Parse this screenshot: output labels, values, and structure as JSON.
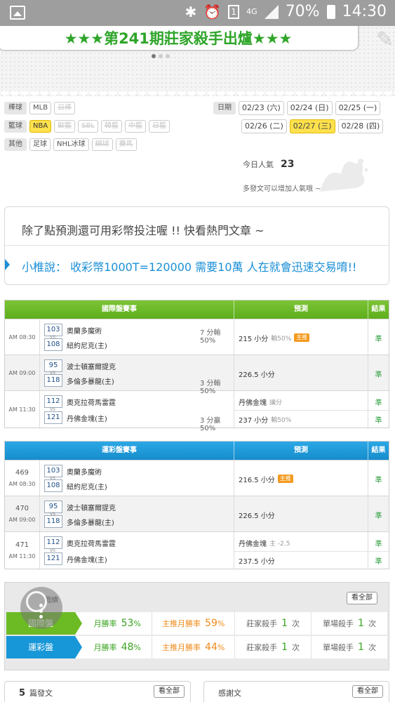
{
  "status_bar": {
    "battery": "70%",
    "time": "14:30",
    "network": "4G",
    "sim": "1"
  },
  "banner": {
    "text": "★★★第241期莊家殺手出爐★★★"
  },
  "filters": {
    "rows": [
      {
        "category": "棒球",
        "items": [
          {
            "label": "MLB",
            "state": "normal"
          },
          {
            "label": "日棒",
            "state": "off"
          }
        ]
      },
      {
        "category": "籃球",
        "items": [
          {
            "label": "NBA",
            "state": "on"
          },
          {
            "label": "歐籃",
            "state": "off"
          },
          {
            "label": "SBL",
            "state": "off"
          },
          {
            "label": "韓籃",
            "state": "off"
          },
          {
            "label": "中籃",
            "state": "off"
          },
          {
            "label": "日籃",
            "state": "off"
          }
        ]
      },
      {
        "category": "其他",
        "items": [
          {
            "label": "足球",
            "state": "normal"
          },
          {
            "label": "NHL冰球",
            "state": "normal"
          },
          {
            "label": "網球",
            "state": "off"
          },
          {
            "label": "賽馬",
            "state": "off"
          }
        ]
      }
    ]
  },
  "dates": {
    "label": "日期",
    "row1": [
      {
        "label": "02/23 (六)",
        "active": false
      },
      {
        "label": "02/24 (日)",
        "active": false
      },
      {
        "label": "02/25 (一)",
        "active": false
      }
    ],
    "row2": [
      {
        "label": "02/26 (二)",
        "active": false
      },
      {
        "label": "02/27 (三)",
        "active": true
      },
      {
        "label": "02/28 (四)",
        "active": false
      }
    ]
  },
  "popularity": {
    "label": "今日人氣",
    "value": "23",
    "hint": "多發文可以增加人氣哦 ~"
  },
  "notice": {
    "line1": "除了點預測還可用彩幣投注喔 !! 快看熱門文章 ~",
    "line2": "小椎說： 收彩幣1000T=120000 需要10萬 人在就會迅速交易唷!!"
  },
  "intl_table": {
    "header": {
      "match": "國際盤賽事",
      "prediction": "預測",
      "result": "結果"
    },
    "rows": [
      {
        "time": "AM 08:30",
        "away_no": "103",
        "away": "奧蘭多魔術",
        "home_no": "108",
        "home": "紐約尼克(主)",
        "line": "7 分輸50%",
        "line_on": "away",
        "preds": [
          {
            "text": "215 小分",
            "sub": "輸50%",
            "badge": "主推",
            "result": "準"
          }
        ]
      },
      {
        "time": "AM 09:00",
        "away_no": "95",
        "away": "波士頓塞爾提克",
        "home_no": "118",
        "home": "多倫多暴龍(主)",
        "line": "3 分輸50%",
        "line_on": "home",
        "preds": [
          {
            "text": "226.5 小分",
            "sub": "",
            "badge": "",
            "result": "準"
          }
        ]
      },
      {
        "time": "AM 11:30",
        "away_no": "112",
        "away": "奧克拉荷馬雷霆",
        "home_no": "121",
        "home": "丹佛金塊(主)",
        "line": "3 分贏50%",
        "line_on": "home",
        "preds": [
          {
            "text": "丹佛金塊",
            "sub": "讓分",
            "badge": "",
            "result": "準"
          },
          {
            "text": "237 小分",
            "sub": "輸50%",
            "badge": "",
            "result": "準"
          }
        ]
      }
    ]
  },
  "lottery_table": {
    "header": {
      "match": "運彩盤賽事",
      "prediction": "預測",
      "result": "結果"
    },
    "rows": [
      {
        "game_id": "469",
        "time": "AM 08:30",
        "away_no": "103",
        "away": "奧蘭多魔術",
        "home_no": "108",
        "home": "紐約尼克(主)",
        "preds": [
          {
            "text": "216.5 小分",
            "sub": "",
            "badge": "主推",
            "result": "準"
          }
        ]
      },
      {
        "game_id": "470",
        "time": "AM 09:00",
        "away_no": "95",
        "away": "波士頓塞爾提克",
        "home_no": "118",
        "home": "多倫多暴龍(主)",
        "preds": [
          {
            "text": "226.5 小分",
            "sub": "",
            "badge": "",
            "result": "準"
          }
        ]
      },
      {
        "game_id": "471",
        "time": "AM 11:30",
        "away_no": "112",
        "away": "奧克拉荷馬雷霆",
        "home_no": "121",
        "home": "丹佛金塊(主)",
        "preds": [
          {
            "text": "丹佛金塊",
            "sub": "主 -2.5",
            "badge": "",
            "result": "準"
          },
          {
            "text": "237.5 小分",
            "sub": "",
            "badge": "",
            "result": "準"
          }
        ]
      }
    ]
  },
  "stats": {
    "title": "戰績",
    "view_all": "看全部",
    "rows": [
      {
        "label": "國際盤",
        "win_rate_label": "月勝率",
        "win_rate": "53",
        "main_rate_label": "主推月勝率",
        "main_rate": "59",
        "killer_label": "莊家殺手",
        "killer": "1",
        "single_label": "單場殺手",
        "single": "1",
        "unit": "次",
        "pct": "%"
      },
      {
        "label": "運彩盤",
        "win_rate_label": "月勝率",
        "win_rate": "48",
        "main_rate_label": "主推月勝率",
        "main_rate": "44",
        "killer_label": "莊家殺手",
        "killer": "1",
        "single_label": "單場殺手",
        "single": "1",
        "unit": "次",
        "pct": "%"
      }
    ]
  },
  "posts": {
    "count": "5",
    "label": "篇發文",
    "view_all": "看全部"
  },
  "thanks": {
    "label": "感謝文",
    "view_all": "看全部"
  },
  "colors": {
    "green": "#6cbb24",
    "blue": "#1797d8",
    "orange": "#f08a1a",
    "highlight": "#ffe14d"
  }
}
